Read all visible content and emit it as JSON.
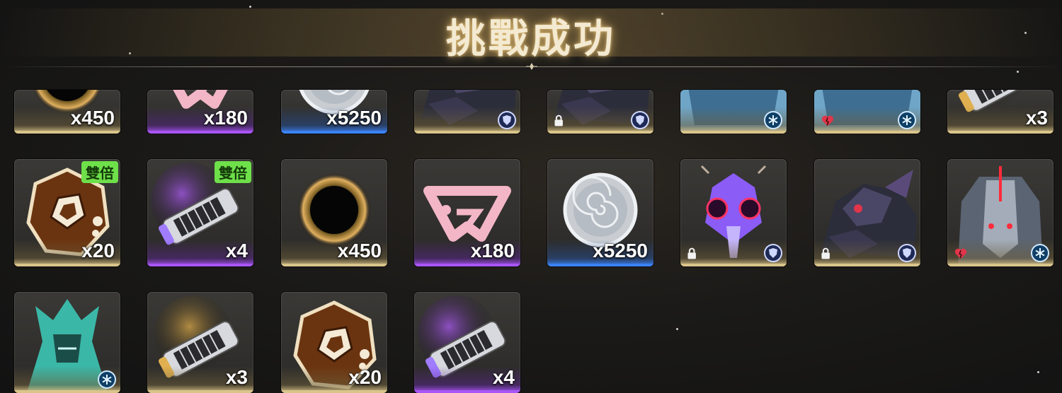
{
  "header": {
    "title": "挑戰成功"
  },
  "badges": {
    "double": "雙倍"
  },
  "rows": [
    {
      "items": [
        {
          "art": "gold-ring-icon",
          "quality": "gold",
          "qty": "x450"
        },
        {
          "art": "pink-emblem-icon",
          "quality": "purple",
          "qty": "x180"
        },
        {
          "art": "silver-coin-icon",
          "quality": "blue",
          "qty": "x5250"
        },
        {
          "art": "dark-mech-icon",
          "quality": "gold",
          "qty": "",
          "corner": "shield"
        },
        {
          "art": "dark-mech-icon",
          "quality": "gold",
          "qty": "",
          "corner": "shield",
          "lock": true
        },
        {
          "art": "ice-mech-icon",
          "quality": "gold",
          "qty": "",
          "corner": "snow"
        },
        {
          "art": "ice-mech-icon",
          "quality": "gold",
          "qty": "",
          "corner": "snow",
          "heart": true
        },
        {
          "art": "gold-cylinder-icon",
          "quality": "gold",
          "qty": "x3"
        }
      ]
    },
    {
      "items": [
        {
          "art": "orange-dice-icon",
          "quality": "gold",
          "qty": "x20",
          "double": true
        },
        {
          "art": "purple-cylinder-icon",
          "quality": "purple",
          "qty": "x4",
          "double": true
        },
        {
          "art": "gold-ring-icon",
          "quality": "gold",
          "qty": "x450"
        },
        {
          "art": "pink-emblem-icon",
          "quality": "purple",
          "qty": "x180"
        },
        {
          "art": "silver-coin-icon",
          "quality": "blue",
          "qty": "x5250"
        },
        {
          "art": "purple-insect-mech-icon",
          "quality": "gold",
          "qty": "",
          "corner": "shield",
          "lock": true
        },
        {
          "art": "dark-mech-icon",
          "quality": "gold",
          "qty": "",
          "corner": "shield",
          "lock": true
        },
        {
          "art": "red-mech-icon",
          "quality": "gold",
          "qty": "",
          "corner": "snow",
          "heart": true
        }
      ]
    },
    {
      "items": [
        {
          "art": "teal-mech-icon",
          "quality": "gold",
          "qty": "",
          "corner": "snow"
        },
        {
          "art": "gold-cylinder-icon",
          "quality": "gold",
          "qty": "x3"
        },
        {
          "art": "orange-dice-icon",
          "quality": "gold",
          "qty": "x20"
        },
        {
          "art": "purple-cylinder-icon",
          "quality": "purple",
          "qty": "x4"
        }
      ]
    }
  ],
  "colors": {
    "gold": "#d9c48a",
    "purple": "#a855f7",
    "blue": "#3b82f6",
    "double_badge": "#6ee04a"
  }
}
